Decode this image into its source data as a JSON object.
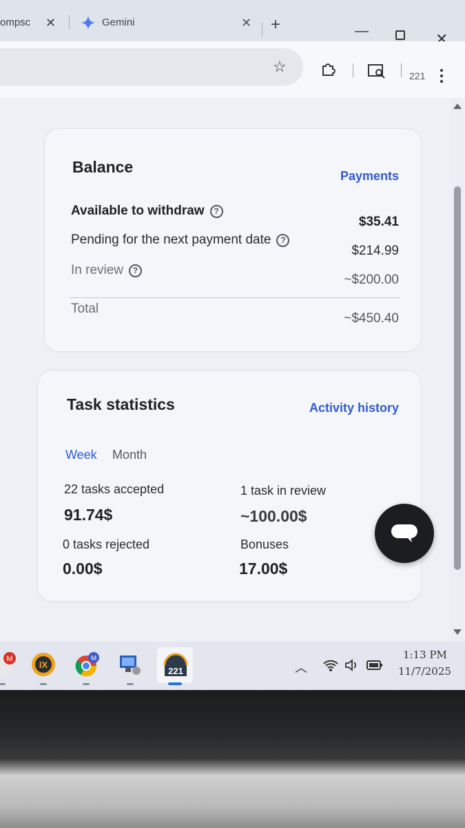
{
  "browser": {
    "tabs": [
      {
        "title": "ompsc",
        "close": "✕"
      },
      {
        "title": "Gemini",
        "close": "✕"
      }
    ],
    "new_tab": "+",
    "toolbar": {
      "profile_count": "221"
    }
  },
  "balance": {
    "title": "Balance",
    "link": "Payments",
    "rows": [
      {
        "label": "Available to withdraw",
        "value": "$35.41"
      },
      {
        "label": "Pending for the next payment date",
        "value": "$214.99"
      },
      {
        "label": "In review",
        "value": "~$200.00"
      },
      {
        "label": "Total",
        "value": "~$450.40"
      }
    ],
    "help_glyph": "?"
  },
  "task_statistics": {
    "title": "Task statistics",
    "link": "Activity history",
    "period_tabs": [
      {
        "label": "Week",
        "active": true
      },
      {
        "label": "Month",
        "active": false
      }
    ],
    "stats": [
      {
        "label": "22 tasks accepted",
        "value": "91.74$"
      },
      {
        "label": "1 task in review",
        "value": "~100.00$"
      },
      {
        "label": "0 tasks rejected",
        "value": "0.00$"
      },
      {
        "label": "Bonuses",
        "value": "17.00$"
      }
    ]
  },
  "taskbar": {
    "apps": [
      {
        "icon": "gmail-icon",
        "badge": "M"
      },
      {
        "icon": "ix-app-icon",
        "label": "IX"
      },
      {
        "icon": "chrome-profile-icon",
        "badge": "M"
      },
      {
        "icon": "network-pc-icon"
      },
      {
        "icon": "pinned-app-icon",
        "label": "221"
      }
    ],
    "clock": {
      "time": "1:13 PM",
      "date": "11/7/2025"
    }
  },
  "colors": {
    "accent_link": "#2f5cd6",
    "card_bg": "#f5f6fa",
    "page_bg": "#eef0f5",
    "fab_bg": "#1c1d20"
  }
}
